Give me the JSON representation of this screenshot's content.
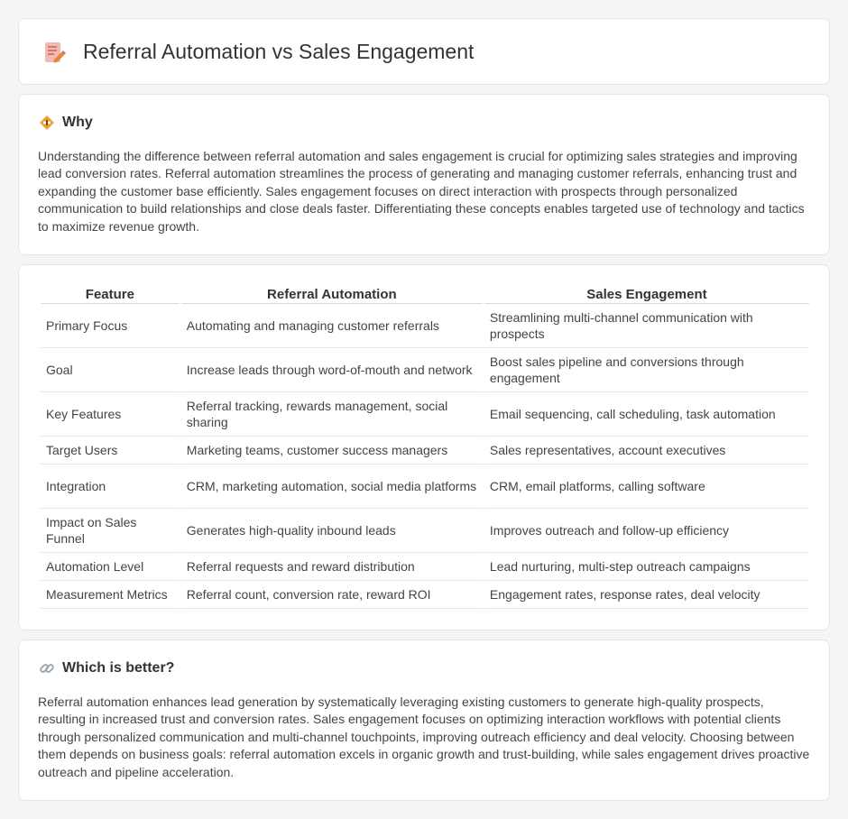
{
  "header": {
    "title": "Referral Automation vs Sales Engagement",
    "icon": "document-pencil-icon"
  },
  "why": {
    "icon": "bulb-badge-icon",
    "title": "Why",
    "text": "Understanding the difference between referral automation and sales engagement is crucial for optimizing sales strategies and improving lead conversion rates. Referral automation streamlines the process of generating and managing customer referrals, enhancing trust and expanding the customer base efficiently. Sales engagement focuses on direct interaction with prospects through personalized communication to build relationships and close deals faster. Differentiating these concepts enables targeted use of technology and tactics to maximize revenue growth."
  },
  "table": {
    "headers": [
      "Feature",
      "Referral Automation",
      "Sales Engagement"
    ],
    "rows": [
      [
        "Primary Focus",
        "Automating and managing customer referrals",
        "Streamlining multi-channel communication with prospects"
      ],
      [
        "Goal",
        "Increase leads through word-of-mouth and network",
        "Boost sales pipeline and conversions through engagement"
      ],
      [
        "Key Features",
        "Referral tracking, rewards management, social sharing",
        "Email sequencing, call scheduling, task automation"
      ],
      [
        "Target Users",
        "Marketing teams, customer success managers",
        "Sales representatives, account executives"
      ],
      [
        "Integration",
        "CRM, marketing automation, social media platforms",
        "CRM, email platforms, calling software"
      ],
      [
        "Impact on Sales Funnel",
        "Generates high-quality inbound leads",
        "Improves outreach and follow-up efficiency"
      ],
      [
        "Automation Level",
        "Referral requests and reward distribution",
        "Lead nurturing, multi-step outreach campaigns"
      ],
      [
        "Measurement Metrics",
        "Referral count, conversion rate, reward ROI",
        "Engagement rates, response rates, deal velocity"
      ]
    ]
  },
  "better": {
    "icon": "link-icon",
    "title": "Which is better?",
    "text": "Referral automation enhances lead generation by systematically leveraging existing customers to generate high-quality prospects, resulting in increased trust and conversion rates. Sales engagement focuses on optimizing interaction workflows with potential clients through personalized communication and multi-channel touchpoints, improving outreach efficiency and deal velocity. Choosing between them depends on business goals: referral automation excels in organic growth and trust-building, while sales engagement drives proactive outreach and pipeline acceleration."
  },
  "colors": {
    "background": "#f4f5f7",
    "card": "#ffffff",
    "border": "#e1e4e8",
    "text": "#333333"
  }
}
